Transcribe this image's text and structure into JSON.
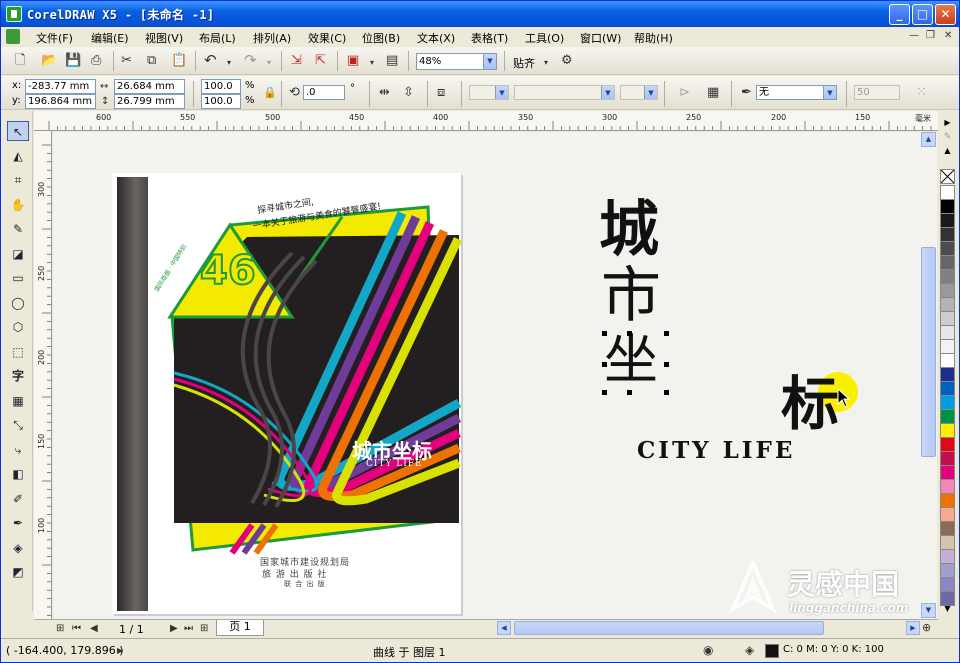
{
  "window": {
    "title": "CorelDRAW X5 - [未命名 -1]",
    "min": "_",
    "max": "□",
    "close": "✕"
  },
  "menu": {
    "items": [
      "文件(F)",
      "编辑(E)",
      "视图(V)",
      "布局(L)",
      "排列(A)",
      "效果(C)",
      "位图(B)",
      "文本(X)",
      "表格(T)",
      "工具(O)",
      "窗口(W)",
      "帮助(H)"
    ],
    "mdi_min": "—",
    "mdi_restore": "❐",
    "mdi_close": "✕"
  },
  "toolbar1": {
    "zoom": "48%",
    "snap_label": "贴齐"
  },
  "toolbar2": {
    "x_label": "x:",
    "y_label": "y:",
    "x_value": "-283.77 mm",
    "y_value": "196.864 mm",
    "width_value": "26.684 mm",
    "height_value": "26.799 mm",
    "scale_x": "100.0",
    "scale_y": "100.0",
    "percent": "%",
    "rotation": ".0",
    "degree": "°",
    "outline_none": "无",
    "outline_width": "50"
  },
  "ruler": {
    "unit": "毫米",
    "h_labels": [
      "600",
      "550",
      "500",
      "450",
      "400",
      "350",
      "300",
      "250",
      "200",
      "150"
    ],
    "v_labels": [
      "300",
      "250",
      "200",
      "150",
      "100"
    ]
  },
  "cover": {
    "slogan_1": "探寻城市之间,",
    "slogan_2": "一本关于旅游与美食的饕餮盛宴!",
    "issue_number": "46",
    "side_tag": "国际版面 · 中国特别",
    "title_cn": "城市坐标",
    "title_en": "CITY LIFE",
    "publisher_1": "国家城市建设规划局",
    "publisher_2": "旅  游  出  版  社",
    "publisher_3": "联  合  出  版"
  },
  "logo": {
    "char_1": "城",
    "char_2": "市",
    "char_3": "坐",
    "char_4": "标",
    "tagline": "CITY LIFE"
  },
  "palette": {
    "colors": [
      "#ffffff",
      "#000000",
      "#1a1a1a",
      "#333333",
      "#4d4d4d",
      "#666666",
      "#808080",
      "#999999",
      "#b3b3b3",
      "#cccccc",
      "#e6e6e6",
      "#f2f2f2",
      "#ffffff",
      "#1c2f8f",
      "#0061c4",
      "#009ee0",
      "#00923f",
      "#ffed00",
      "#e30613",
      "#c50d4e",
      "#e4007c",
      "#f088b6",
      "#ee7203",
      "#f4a990",
      "#8c6a5b",
      "#d4c4ac",
      "#c4b0d6",
      "#a09fd0",
      "#8a87c2",
      "#6e6aa9"
    ]
  },
  "nav": {
    "page_count": "1 / 1",
    "page_tab": "页 1"
  },
  "status": {
    "coords": "( -164.400, 179.896 )",
    "object_info": "曲线 于 图层 1",
    "fill_info": "C: 0 M: 0 Y: 0 K: 100"
  },
  "watermark": {
    "brand": "灵感中国",
    "url": "lingganchina.com"
  }
}
